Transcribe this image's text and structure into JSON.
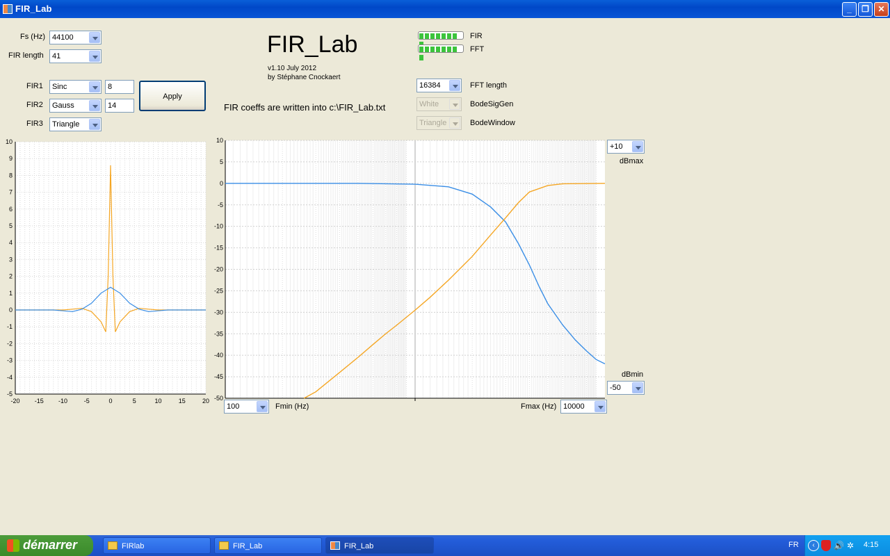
{
  "window": {
    "title": "FIR_Lab"
  },
  "controls": {
    "fs_label": "Fs (Hz)",
    "fs_value": "44100",
    "firlen_label": "FIR length",
    "firlen_value": "41",
    "fir1_label": "FIR1",
    "fir1_type": "Sinc",
    "fir1_param": "8",
    "fir2_label": "FIR2",
    "fir2_type": "Gauss",
    "fir2_param": "14",
    "fir3_label": "FIR3",
    "fir3_type": "Triangle",
    "apply_label": "Apply"
  },
  "header": {
    "app_name": "FIR_Lab",
    "version": "v1.10 July 2012",
    "author": "by Stéphane Cnockaert",
    "note": "FIR coeffs are written into c:\\FIR_Lab.txt",
    "fir_progress_label": "FIR",
    "fft_progress_label": "FFT",
    "fir_progress": 1.0,
    "fft_progress": 1.0,
    "fft_length_value": "16384",
    "fft_length_label": "FFT length",
    "bodesiggen_value": "White",
    "bodesiggen_label": "BodeSigGen",
    "bodewindow_value": "Triangle",
    "bodewindow_label": "BodeWindow"
  },
  "bode": {
    "dbmax_value": "+10",
    "dbmax_label": "dBmax",
    "dbmin_value": "-50",
    "dbmin_label": "dBmin",
    "fmin_value": "100",
    "fmin_label": "Fmin (Hz)",
    "fmax_value": "10000",
    "fmax_label": "Fmax (Hz)"
  },
  "taskbar": {
    "start_label": "démarrer",
    "tasks": [
      "FIRlab",
      "FIR_Lab",
      "FIR_Lab"
    ],
    "lang": "FR",
    "clock": "4:15"
  },
  "chart_data": [
    {
      "type": "line",
      "title": "",
      "xlim": [
        -20,
        20
      ],
      "ylim": [
        -5,
        10
      ],
      "xticks": [
        "-20",
        "-15",
        "-10",
        "-5",
        "0",
        "5",
        "10",
        "15",
        "20"
      ],
      "yticks": [
        "10",
        "9",
        "8",
        "7",
        "6",
        "5",
        "4",
        "3",
        "2",
        "1",
        "0",
        "-1",
        "-2",
        "-3",
        "-4",
        "-5"
      ],
      "grid": true,
      "series": [
        {
          "color": "#f5a623",
          "x": [
            -20,
            -10,
            -8,
            -6,
            -4,
            -2,
            -1,
            -0.5,
            0,
            0.5,
            1,
            2,
            4,
            6,
            8,
            10,
            20
          ],
          "y": [
            0,
            0,
            0.05,
            0.1,
            -0.1,
            -0.7,
            -1.3,
            2,
            8.6,
            2,
            -1.3,
            -0.7,
            -0.1,
            0.1,
            0.05,
            0,
            0
          ]
        },
        {
          "color": "#3a8ee6",
          "x": [
            -20,
            -12,
            -10,
            -8,
            -6,
            -4,
            -2,
            0,
            2,
            4,
            6,
            8,
            10,
            12,
            20
          ],
          "y": [
            0,
            0,
            -0.05,
            -0.1,
            0.05,
            0.4,
            1.0,
            1.35,
            1.0,
            0.4,
            0.05,
            -0.1,
            -0.05,
            0,
            0
          ]
        }
      ]
    },
    {
      "type": "line",
      "xscale": "log",
      "xlim": [
        100,
        10000
      ],
      "ylim": [
        -50,
        10
      ],
      "yticks": [
        "10",
        "5",
        "0",
        "-5",
        "-10",
        "-15",
        "-20",
        "-25",
        "-30",
        "-35",
        "-40",
        "-45",
        "-50"
      ],
      "grid": true,
      "series": [
        {
          "color": "#3a8ee6",
          "x": [
            100,
            500,
            1000,
            1500,
            2000,
            2500,
            3000,
            3500,
            4000,
            4500,
            5000,
            6000,
            7000,
            8000,
            9000,
            10000
          ],
          "y": [
            0,
            0,
            -0.2,
            -0.8,
            -2.5,
            -5.5,
            -9,
            -14,
            -19,
            -24,
            -28,
            -33,
            -36.5,
            -39,
            -41,
            -42
          ]
        },
        {
          "color": "#f5a623",
          "x": [
            260,
            300,
            400,
            500,
            600,
            700,
            800,
            1000,
            1200,
            1500,
            2000,
            2500,
            3000,
            3500,
            4000,
            5000,
            6000,
            10000
          ],
          "y": [
            -50,
            -48.5,
            -44,
            -40.5,
            -37.5,
            -35,
            -33,
            -29.5,
            -26.5,
            -22.5,
            -17,
            -12,
            -8,
            -4.5,
            -2,
            -0.5,
            -0.1,
            0
          ]
        }
      ]
    }
  ]
}
